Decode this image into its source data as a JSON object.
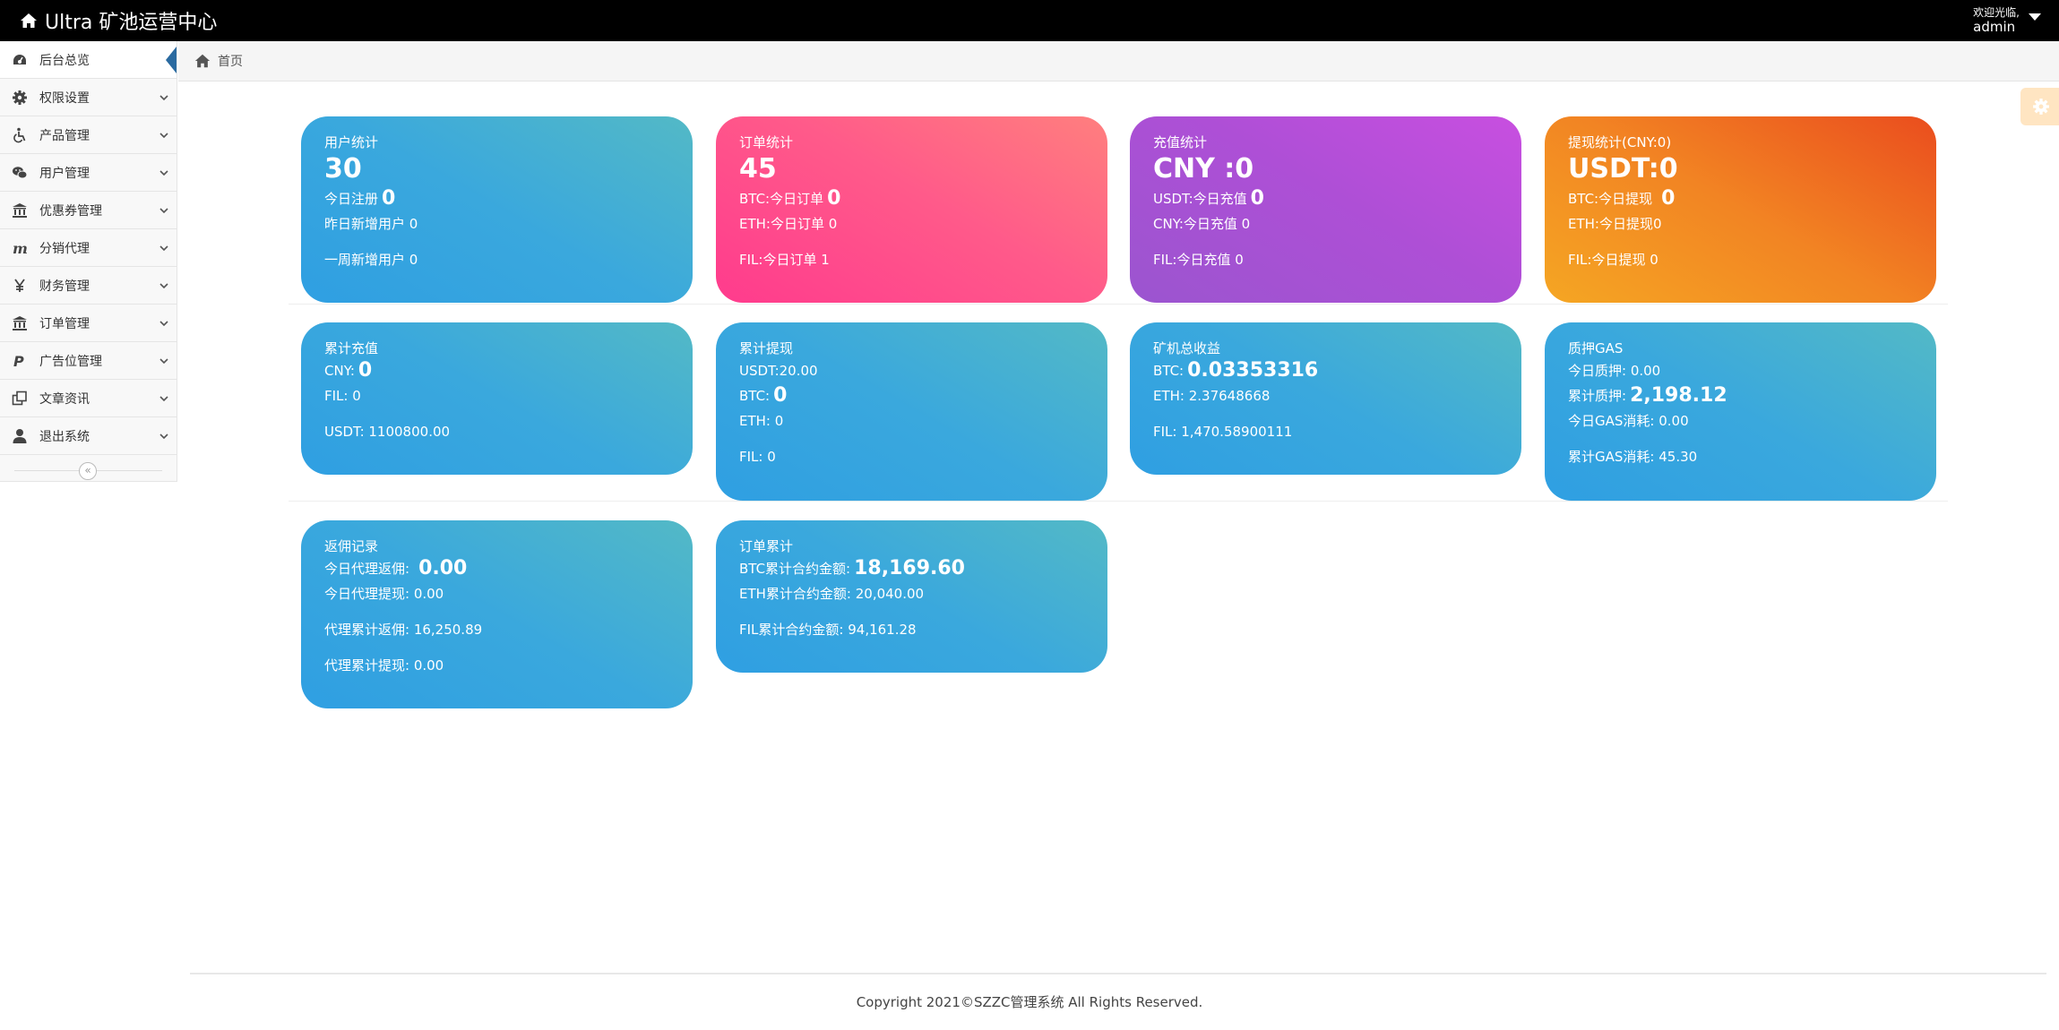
{
  "app": {
    "title": "Ultra 矿池运营中心"
  },
  "user": {
    "welcome": "欢迎光临,",
    "name": "admin"
  },
  "sidebar": {
    "items": [
      {
        "label": "后台总览",
        "icon": "dashboard-icon"
      },
      {
        "label": "权限设置",
        "icon": "gear-icon"
      },
      {
        "label": "产品管理",
        "icon": "wheelchair-icon"
      },
      {
        "label": "用户管理",
        "icon": "wechat-icon"
      },
      {
        "label": "优惠券管理",
        "icon": "bank-icon"
      },
      {
        "label": "分销代理",
        "icon": "m-letter-icon"
      },
      {
        "label": "财务管理",
        "icon": "yen-icon"
      },
      {
        "label": "订单管理",
        "icon": "bank-icon"
      },
      {
        "label": "广告位管理",
        "icon": "paypal-icon"
      },
      {
        "label": "文章资讯",
        "icon": "clone-icon"
      },
      {
        "label": "退出系统",
        "icon": "user-icon"
      }
    ],
    "collapse_label": "«"
  },
  "breadcrumb": {
    "home": "首页"
  },
  "cards": {
    "users": {
      "title": "用户统计",
      "total": "30",
      "today_label": "今日注册",
      "today_value": "0",
      "yesterday": "昨日新增用户  0",
      "week": "一周新增用户  0"
    },
    "orders": {
      "title": "订单统计",
      "total": "45",
      "btc_label": "BTC:今日订单",
      "btc_value": "0",
      "eth": "ETH:今日订单  0",
      "fil": "FIL:今日订单  1"
    },
    "recharge": {
      "title": "充值统计",
      "total": "CNY :0",
      "usdt_label": "USDT:今日充值",
      "usdt_value": "0",
      "cny": "CNY:今日充值  0",
      "fil": "FIL:今日充值  0"
    },
    "withdraw": {
      "title": "提现统计(CNY:0)",
      "total": "USDT:0",
      "btc_label": "BTC:今日提现",
      "btc_value": "0",
      "eth": "ETH:今日提现0",
      "fil": "FIL:今日提现  0"
    },
    "acc_recharge": {
      "title": "累计充值",
      "cny_label": "CNY:",
      "cny_value": "0",
      "fil": "FIL: 0",
      "usdt": "USDT: 1100800.00"
    },
    "acc_withdraw": {
      "title": "累计提现",
      "usdt": "USDT:20.00",
      "btc_label": "BTC:",
      "btc_value": "0",
      "eth": "ETH: 0",
      "fil": "FIL: 0"
    },
    "mining": {
      "title": "矿机总收益",
      "btc_label": "BTC:",
      "btc_value": "0.03353316",
      "eth": "ETH: 2.37648668",
      "fil": "FIL: 1,470.58900111"
    },
    "gas": {
      "title": "质押GAS",
      "today": "今日质押:  0.00",
      "acc_label": "累计质押:",
      "acc_value": "2,198.12",
      "today_gas": "今日GAS消耗: 0.00",
      "acc_gas": "累计GAS消耗: 45.30"
    },
    "rebate": {
      "title": "返佣记录",
      "today_label": "今日代理返佣:",
      "today_value": "0.00",
      "today_withdraw": "今日代理提现:   0.00",
      "acc_rebate": "代理累计返佣:   16,250.89",
      "acc_withdraw": "代理累计提现:   0.00"
    },
    "order_acc": {
      "title": "订单累计",
      "btc_label": "BTC累计合约金额:",
      "btc_value": "18,169.60",
      "eth": "ETH累计合约金额:   20,040.00",
      "fil": "FIL累计合约金额:   94,161.28"
    }
  },
  "footer": {
    "copyright": "Copyright 2021©SZZC管理系统 All Rights Reserved."
  }
}
